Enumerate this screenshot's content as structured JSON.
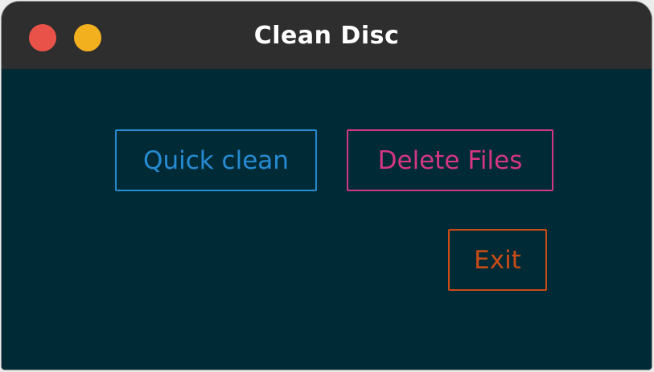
{
  "window": {
    "title": "Clean Disc",
    "controls": {
      "close_icon": "close-dot",
      "minimize_icon": "minimize-dot"
    }
  },
  "buttons": {
    "quick_clean": "Quick clean",
    "delete_files": "Delete Files",
    "exit": "Exit"
  },
  "colors": {
    "background": "#002b36",
    "titlebar": "#2e2e2e",
    "quick_clean": "#268bd2",
    "delete_files": "#d33682",
    "exit": "#cb4b16",
    "close": "#e95249",
    "minimize": "#f2b01e"
  }
}
